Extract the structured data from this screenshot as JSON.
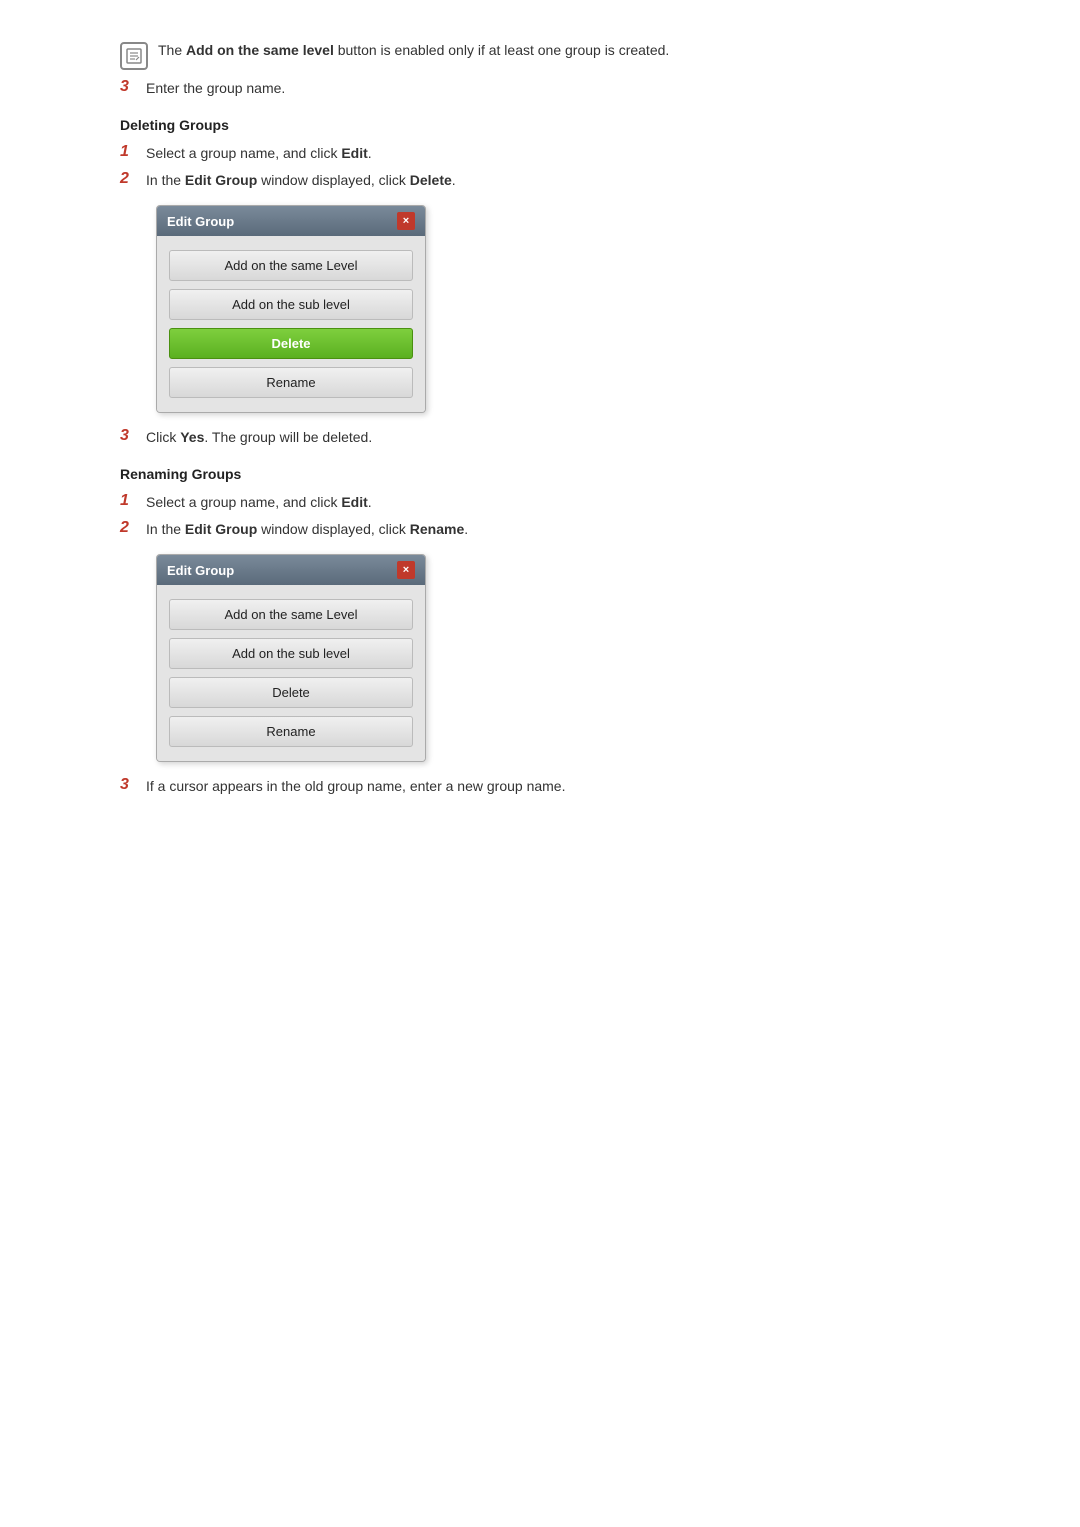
{
  "note": {
    "icon_label": "note-icon",
    "text_before": "The ",
    "bold_text": "Add on the same level",
    "text_after": " button is enabled only if at least one group is created."
  },
  "step3_enter_group": "Enter the group name.",
  "section_deleting": "Deleting Groups",
  "deleting_steps": [
    {
      "num": "1",
      "text_before": "Select a group name, and click ",
      "bold": "Edit",
      "text_after": "."
    },
    {
      "num": "2",
      "text_before": "In the ",
      "bold": "Edit Group",
      "text_after": " window displayed, click ",
      "bold2": "Delete",
      "end": "."
    }
  ],
  "dialog_delete": {
    "title": "Edit Group",
    "close": "×",
    "buttons": [
      {
        "label": "Add on the same Level",
        "active": false
      },
      {
        "label": "Add on the sub level",
        "active": false
      },
      {
        "label": "Delete",
        "active": true
      },
      {
        "label": "Rename",
        "active": false
      }
    ]
  },
  "step3_click_yes": "Click ",
  "step3_yes_bold": "Yes",
  "step3_yes_after": ". The group will be deleted.",
  "section_renaming": "Renaming Groups",
  "renaming_steps": [
    {
      "num": "1",
      "text_before": "Select a group name, and click ",
      "bold": "Edit",
      "text_after": "."
    },
    {
      "num": "2",
      "text_before": "In the ",
      "bold": "Edit Group",
      "text_after": " window displayed, click ",
      "bold2": "Rename",
      "end": "."
    }
  ],
  "dialog_rename": {
    "title": "Edit Group",
    "close": "×",
    "buttons": [
      {
        "label": "Add on the same Level",
        "active": false
      },
      {
        "label": "Add on the sub level",
        "active": false
      },
      {
        "label": "Delete",
        "active": false
      },
      {
        "label": "Rename",
        "active": false
      }
    ]
  },
  "step3_cursor": "If a cursor appears in the old group name, enter a new group name."
}
